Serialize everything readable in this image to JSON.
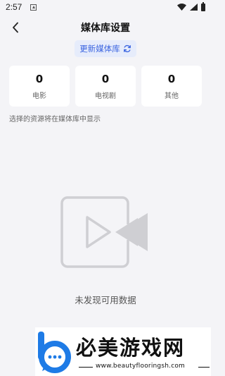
{
  "status_bar": {
    "time": "2:57",
    "icons": [
      "notification-icon",
      "wifi-icon",
      "signal-icon",
      "battery-icon"
    ]
  },
  "header": {
    "title": "媒体库设置",
    "back_icon": "chevron-left-icon"
  },
  "update_button": {
    "label": "更新媒体库",
    "icon": "refresh-icon"
  },
  "stats": [
    {
      "value": "0",
      "label": "电影"
    },
    {
      "value": "0",
      "label": "电视剧"
    },
    {
      "value": "0",
      "label": "其他"
    }
  ],
  "hint": "选择的资源将在媒体库中显示",
  "empty_state": {
    "icon": "video-camera-icon",
    "text": "未发现可用数据"
  },
  "watermark": {
    "title": "必美游戏网",
    "url": "www.beautyflooringsh.com"
  },
  "colors": {
    "accent": "#3a64e0",
    "accent_bg": "#e6ecfb",
    "background": "#f4f4f7",
    "card": "#ffffff",
    "logo_blue": "#1e7be6"
  }
}
